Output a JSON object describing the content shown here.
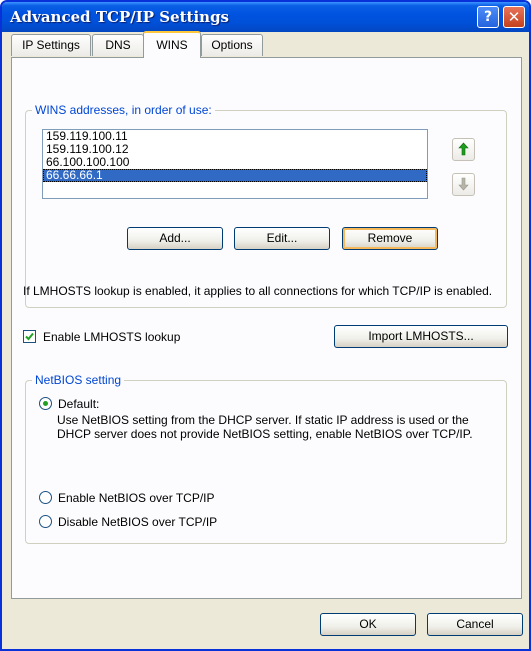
{
  "window": {
    "title": "Advanced TCP/IP Settings"
  },
  "titlebar": {
    "help_glyph": "?",
    "close_glyph": "✕"
  },
  "tabs": [
    {
      "label": "IP Settings"
    },
    {
      "label": "DNS"
    },
    {
      "label": "WINS",
      "active": true
    },
    {
      "label": "Options"
    }
  ],
  "wins": {
    "group_label": "WINS addresses, in order of use:",
    "addresses": [
      "159.119.100.11",
      "159.119.100.12",
      "66.100.100.100",
      "66.66.66.1"
    ],
    "selected_index": 3,
    "add_label": "Add...",
    "edit_label": "Edit...",
    "remove_label": "Remove"
  },
  "lmhosts": {
    "info": "If LMHOSTS lookup is enabled, it applies to all connections for which TCP/IP is enabled.",
    "enable_label": "Enable LMHOSTS lookup",
    "enable_checked": true,
    "import_label": "Import LMHOSTS..."
  },
  "netbios": {
    "group_label": "NetBIOS setting",
    "default_label": "Default:",
    "default_desc": "Use NetBIOS setting from the DHCP server. If static IP address is used or the DHCP server does not provide NetBIOS setting, enable NetBIOS over TCP/IP.",
    "enable_label": "Enable NetBIOS over TCP/IP",
    "disable_label": "Disable NetBIOS over TCP/IP",
    "selected": "default"
  },
  "footer": {
    "ok_label": "OK",
    "cancel_label": "Cancel"
  },
  "colors": {
    "titlebar": "#0053e0",
    "group_label": "#0046d5",
    "selection": "#316ac5",
    "arrow_up": "#1e9e1e"
  },
  "icons": {
    "up": "arrow-up-icon",
    "down": "arrow-down-icon",
    "check": "checkmark-icon"
  }
}
